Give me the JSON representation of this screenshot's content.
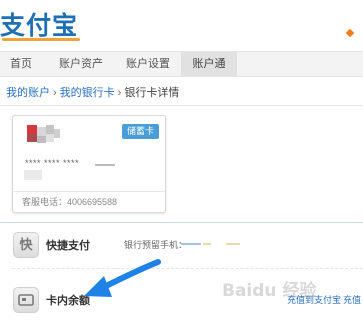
{
  "header": {
    "logo_text": "支付宝"
  },
  "nav": {
    "items": [
      {
        "label": "首页"
      },
      {
        "label": "账户资产"
      },
      {
        "label": "账户设置"
      },
      {
        "label": "账户通"
      }
    ],
    "active_index": 3
  },
  "breadcrumb": {
    "items": [
      "我的账户",
      "我的银行卡",
      "银行卡详情"
    ],
    "separator": "›"
  },
  "card": {
    "tag": "储蓄卡",
    "number_masked": "**** **** ****",
    "service_phone": "客服电话：4006695588"
  },
  "rows": {
    "quick_pay": {
      "icon_glyph": "快",
      "title": "快捷支付",
      "reserved_phone_label": "银行预留手机："
    },
    "balance": {
      "title": "卡内余额"
    }
  },
  "actions": {
    "topup": "充值到支付宝",
    "topup2": "充值"
  },
  "watermark": {
    "text": "Baidu 经验"
  },
  "colors": {
    "brand_blue": "#1f6fb5",
    "link_blue": "#2a6fbf",
    "tag_blue": "#4a9ed6",
    "arrow_blue": "#1f82e6",
    "accent_orange": "#f07c1a"
  }
}
